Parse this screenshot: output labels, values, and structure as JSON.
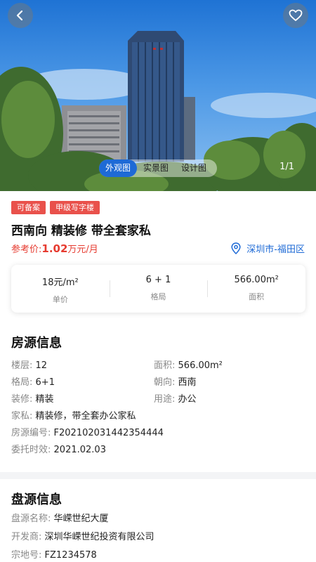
{
  "gallery": {
    "tabs": [
      "外观图",
      "实景图",
      "设计图"
    ],
    "active_tab": 0,
    "counter": "1/1"
  },
  "badges": [
    "可备案",
    "甲级写字楼"
  ],
  "title": "西南向 精装修 带全套家私",
  "price": {
    "prefix": "参考价:",
    "value": "1.02",
    "unit": "万元/月"
  },
  "location": "深圳市-福田区",
  "stats": [
    {
      "value": "18元/m²",
      "label": "单价"
    },
    {
      "value": "6 + 1",
      "label": "格局"
    },
    {
      "value": "566.00m²",
      "label": "面积"
    }
  ],
  "house_info": {
    "title": "房源信息",
    "pairs": [
      {
        "k1": "楼层:",
        "v1": "12",
        "k2": "面积:",
        "v2": "566.00m²"
      },
      {
        "k1": "格局:",
        "v1": "6+1",
        "k2": "朝向:",
        "v2": "西南"
      },
      {
        "k1": "装修:",
        "v1": "精装",
        "k2": "用途:",
        "v2": "办公"
      }
    ],
    "rows": [
      {
        "k": "家私:",
        "v": "精装修，带全套办公家私"
      },
      {
        "k": "房源编号:",
        "v": "F202102031442354444"
      },
      {
        "k": "委托时效:",
        "v": "2021.02.03"
      }
    ]
  },
  "building_info": {
    "title": "盘源信息",
    "rows": [
      {
        "k": "盘源名称:",
        "v": "华嵘世纪大厦"
      },
      {
        "k": "开发商:",
        "v": "深圳华嵘世纪投资有限公司"
      },
      {
        "k": "宗地号:",
        "v": "FZ1234578"
      }
    ]
  },
  "colors": {
    "accent": "#1e6ad6",
    "price": "#e63b30",
    "badge": "#e9514b"
  },
  "icons": {
    "back": "chevron-left-icon",
    "favorite": "heart-icon",
    "location": "location-pin-icon"
  }
}
